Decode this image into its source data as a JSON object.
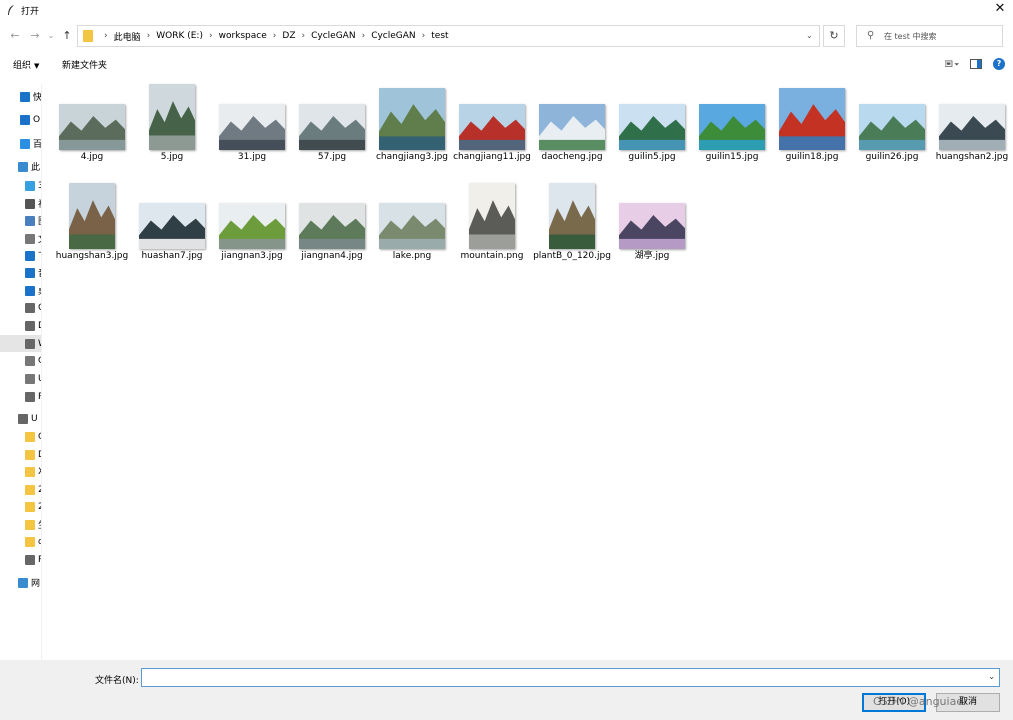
{
  "window": {
    "title": "打开",
    "close_label": "✕"
  },
  "nav": {
    "back": "←",
    "forward": "→",
    "recent": "⌄",
    "up": "↑",
    "breadcrumbs": [
      "此电脑",
      "WORK (E:)",
      "workspace",
      "DZ",
      "CycleGAN",
      "CycleGAN",
      "test"
    ],
    "separator": "›",
    "refresh": "↻",
    "search_placeholder": "在 test 中搜索"
  },
  "toolbar": {
    "organize": "组织",
    "new_folder": "新建文件夹"
  },
  "sidebar": {
    "items": [
      {
        "label": "快",
        "icon": "star-icon"
      },
      {
        "label": "O",
        "icon": "cloud-icon"
      },
      {
        "label": "百",
        "icon": "baidu-icon"
      },
      {
        "label": "此",
        "icon": "computer-icon"
      },
      {
        "label": "3",
        "icon": "cube-icon"
      },
      {
        "label": "视",
        "icon": "video-icon"
      },
      {
        "label": "图",
        "icon": "pictures-icon"
      },
      {
        "label": "文",
        "icon": "documents-icon"
      },
      {
        "label": "下",
        "icon": "download-icon"
      },
      {
        "label": "音",
        "icon": "music-icon"
      },
      {
        "label": "桌",
        "icon": "desktop-icon"
      },
      {
        "label": "C",
        "icon": "drive-icon"
      },
      {
        "label": "D",
        "icon": "drive-icon"
      },
      {
        "label": "W",
        "icon": "drive-icon",
        "selected": true
      },
      {
        "label": "C",
        "icon": "network-drive-icon"
      },
      {
        "label": "U",
        "icon": "network-drive-icon"
      },
      {
        "label": "R",
        "icon": "drive-icon"
      },
      {
        "label": "U",
        "icon": "usb-icon"
      },
      {
        "label": "C",
        "icon": "folder-icon"
      },
      {
        "label": "D",
        "icon": "folder-icon"
      },
      {
        "label": "X",
        "icon": "folder-icon"
      },
      {
        "label": "2",
        "icon": "folder-icon"
      },
      {
        "label": "2",
        "icon": "folder-icon"
      },
      {
        "label": "生",
        "icon": "folder-icon"
      },
      {
        "label": "d",
        "icon": "folder-icon"
      },
      {
        "label": "R",
        "icon": "drive-icon"
      },
      {
        "label": "网",
        "icon": "network-icon"
      }
    ]
  },
  "files": [
    {
      "name": "4.jpg",
      "scene": "lake-pavilion",
      "orient": "land"
    },
    {
      "name": "5.jpg",
      "scene": "garden",
      "orient": "port"
    },
    {
      "name": "31.jpg",
      "scene": "bridge",
      "orient": "land"
    },
    {
      "name": "57.jpg",
      "scene": "village",
      "orient": "land"
    },
    {
      "name": "changjiang3.jpg",
      "scene": "river-gorge",
      "orient": "land"
    },
    {
      "name": "changjiang11.jpg",
      "scene": "red-autumn",
      "orient": "land"
    },
    {
      "name": "daocheng.jpg",
      "scene": "snow-mountain",
      "orient": "land"
    },
    {
      "name": "guilin5.jpg",
      "scene": "elephant-hill",
      "orient": "land"
    },
    {
      "name": "guilin15.jpg",
      "scene": "green-karst",
      "orient": "land"
    },
    {
      "name": "guilin18.jpg",
      "scene": "red-tree",
      "orient": "land"
    },
    {
      "name": "guilin26.jpg",
      "scene": "karst-river",
      "orient": "land"
    },
    {
      "name": "huangshan2.jpg",
      "scene": "misty-peaks",
      "orient": "land"
    },
    {
      "name": "huangshan3.jpg",
      "scene": "rock-peak",
      "orient": "port"
    },
    {
      "name": "huashan7.jpg",
      "scene": "cloud-sea",
      "orient": "land"
    },
    {
      "name": "jiangnan3.jpg",
      "scene": "willow-house",
      "orient": "land"
    },
    {
      "name": "jiangnan4.jpg",
      "scene": "canal",
      "orient": "land"
    },
    {
      "name": "lake.png",
      "scene": "lake-boat",
      "orient": "land"
    },
    {
      "name": "mountain.png",
      "scene": "ink-mountain",
      "orient": "port"
    },
    {
      "name": "plantB_0_120.jpg",
      "scene": "pine-cliff",
      "orient": "port"
    },
    {
      "name": "湖亭.jpg",
      "scene": "lake-pagoda",
      "orient": "land"
    }
  ],
  "footer": {
    "filename_label": "文件名(N):",
    "filename_value": "",
    "open_button": "打开(O)",
    "cancel_button": "取消",
    "watermark": "CSDN @anguiaer"
  },
  "colors": {
    "accent": "#0078d7",
    "folder": "#f4c542",
    "selected": "#e5e5e5"
  }
}
